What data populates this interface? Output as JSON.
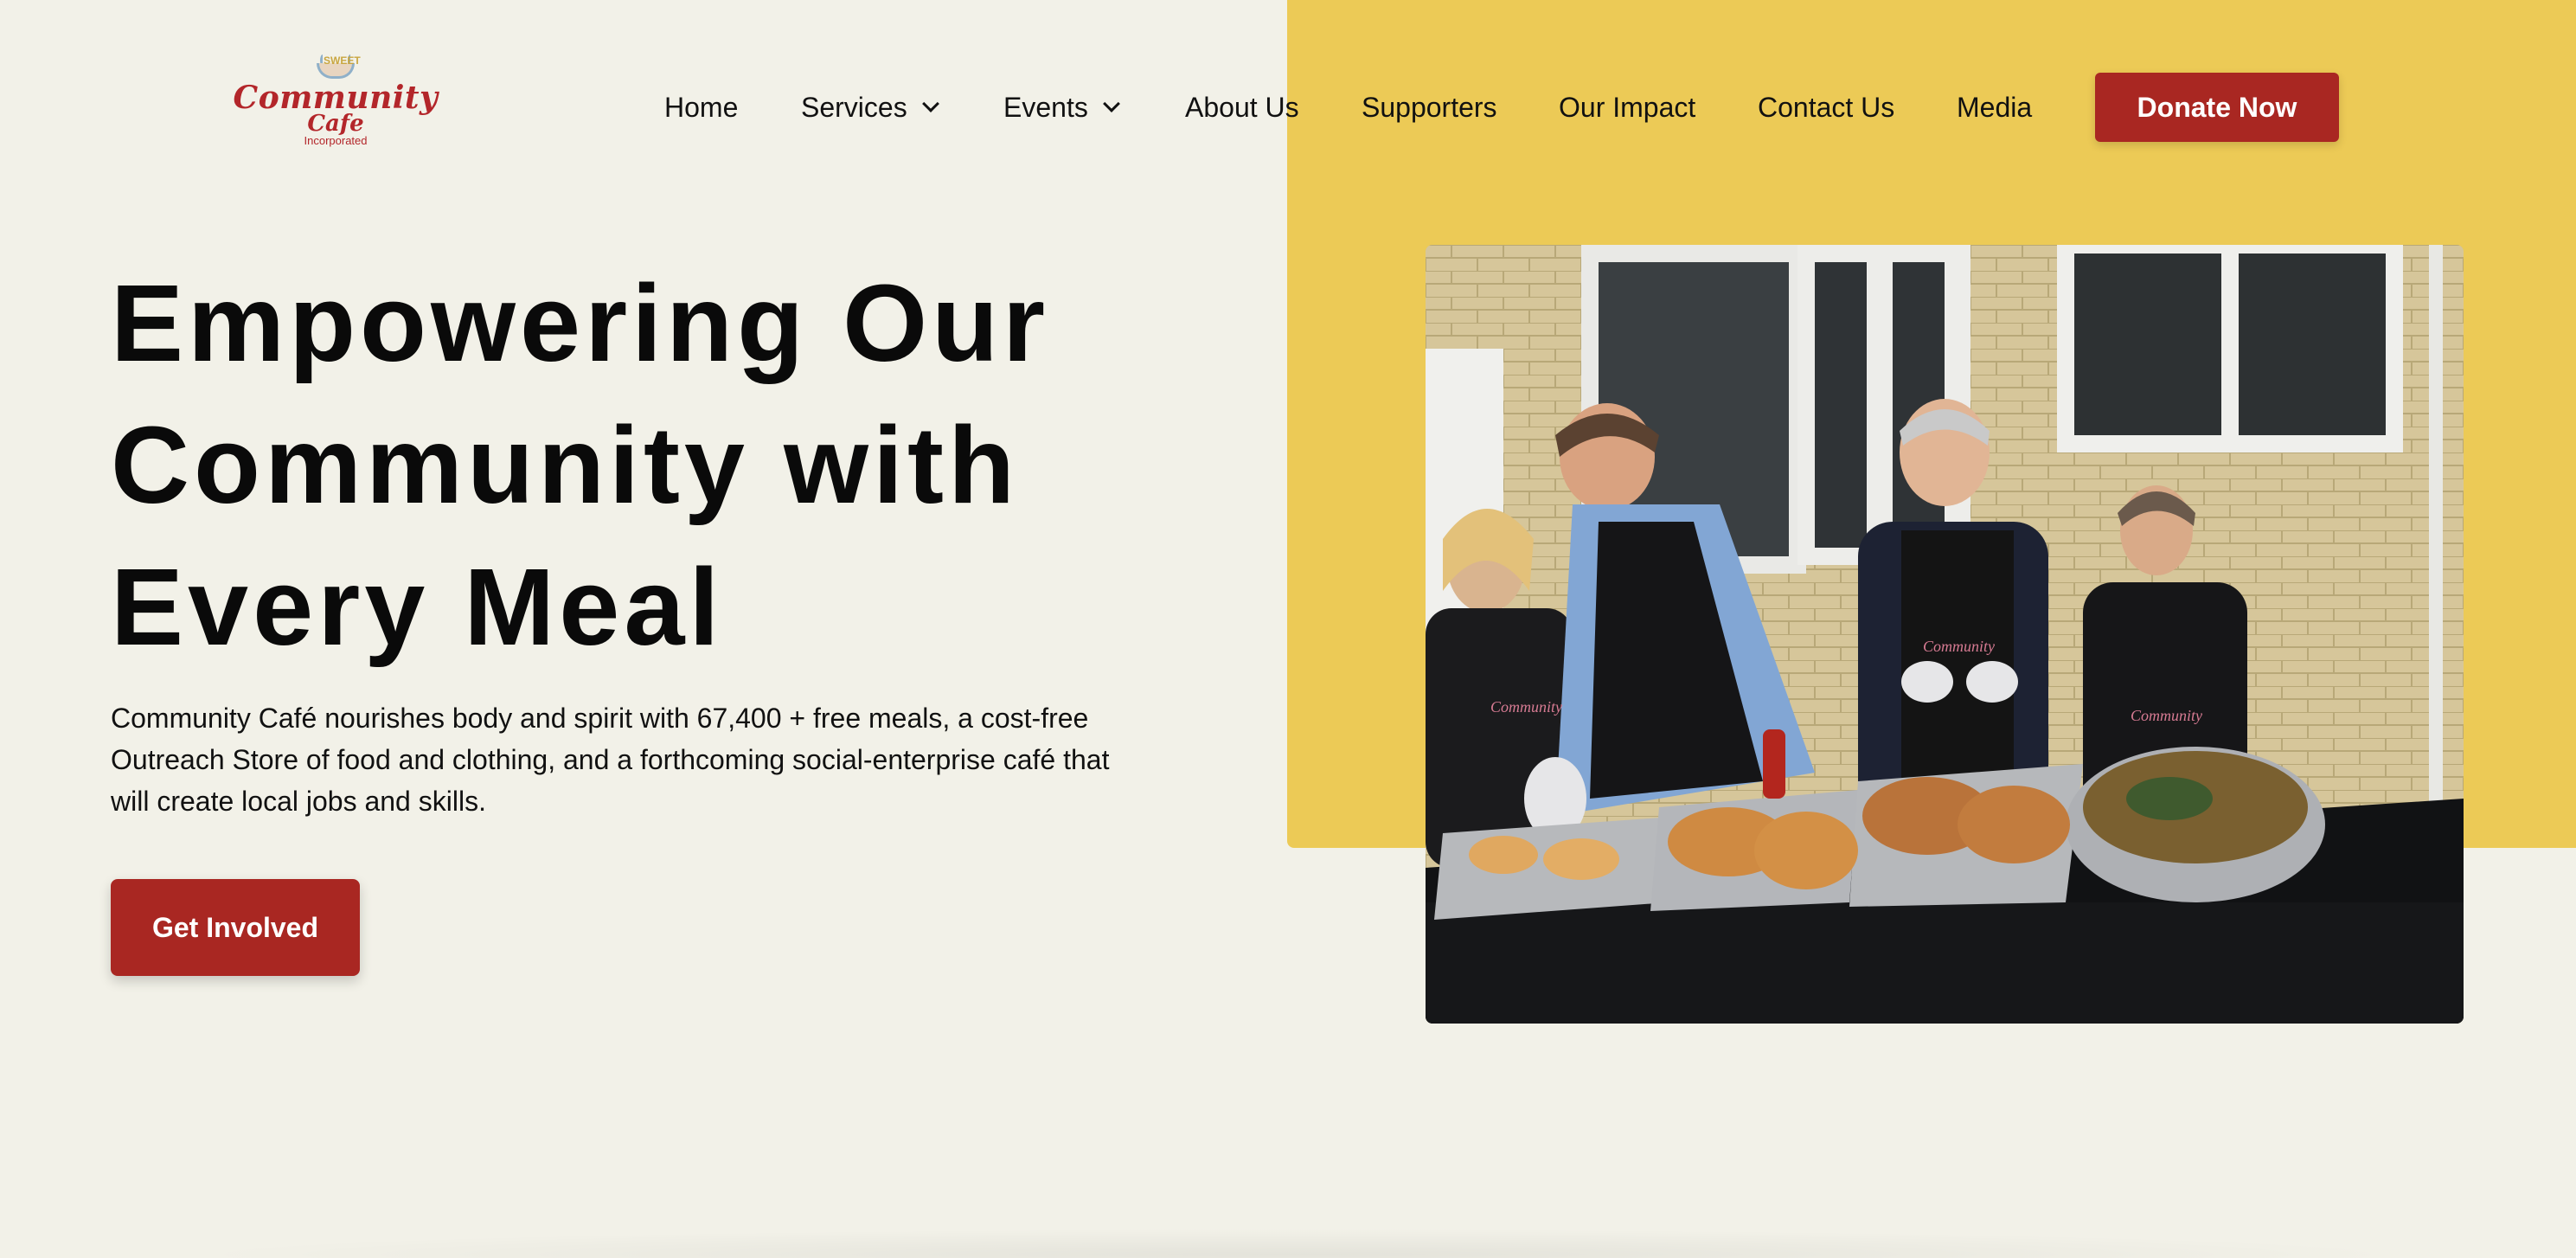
{
  "brand": {
    "logo_line1": "Community",
    "logo_line2": "Cafe",
    "logo_line3": "Incorporated",
    "logo_badge": "SWEET"
  },
  "nav": {
    "items": [
      {
        "label": "Home",
        "has_dropdown": false
      },
      {
        "label": "Services",
        "has_dropdown": true
      },
      {
        "label": "Events",
        "has_dropdown": true
      },
      {
        "label": "About Us",
        "has_dropdown": false
      },
      {
        "label": "Supporters",
        "has_dropdown": false
      },
      {
        "label": "Our Impact",
        "has_dropdown": false
      },
      {
        "label": "Contact Us",
        "has_dropdown": false
      },
      {
        "label": "Media",
        "has_dropdown": false
      }
    ],
    "donate_label": "Donate Now"
  },
  "hero": {
    "title_lines": [
      "Empowering Our",
      "Community with",
      "Every Meal"
    ],
    "description": "Community Café nourishes body and spirit with 67,400 + free meals, a cost-free Outreach Store of food and clothing, and a forthcoming social-enterprise café that will create local jobs and skills.",
    "cta_label": "Get Involved"
  },
  "colors": {
    "background": "#f2f1e8",
    "accent_yellow": "#ecca56",
    "brand_red": "#a92722",
    "text": "#111111"
  },
  "icons": {
    "dropdown": "chevron-down-icon"
  }
}
